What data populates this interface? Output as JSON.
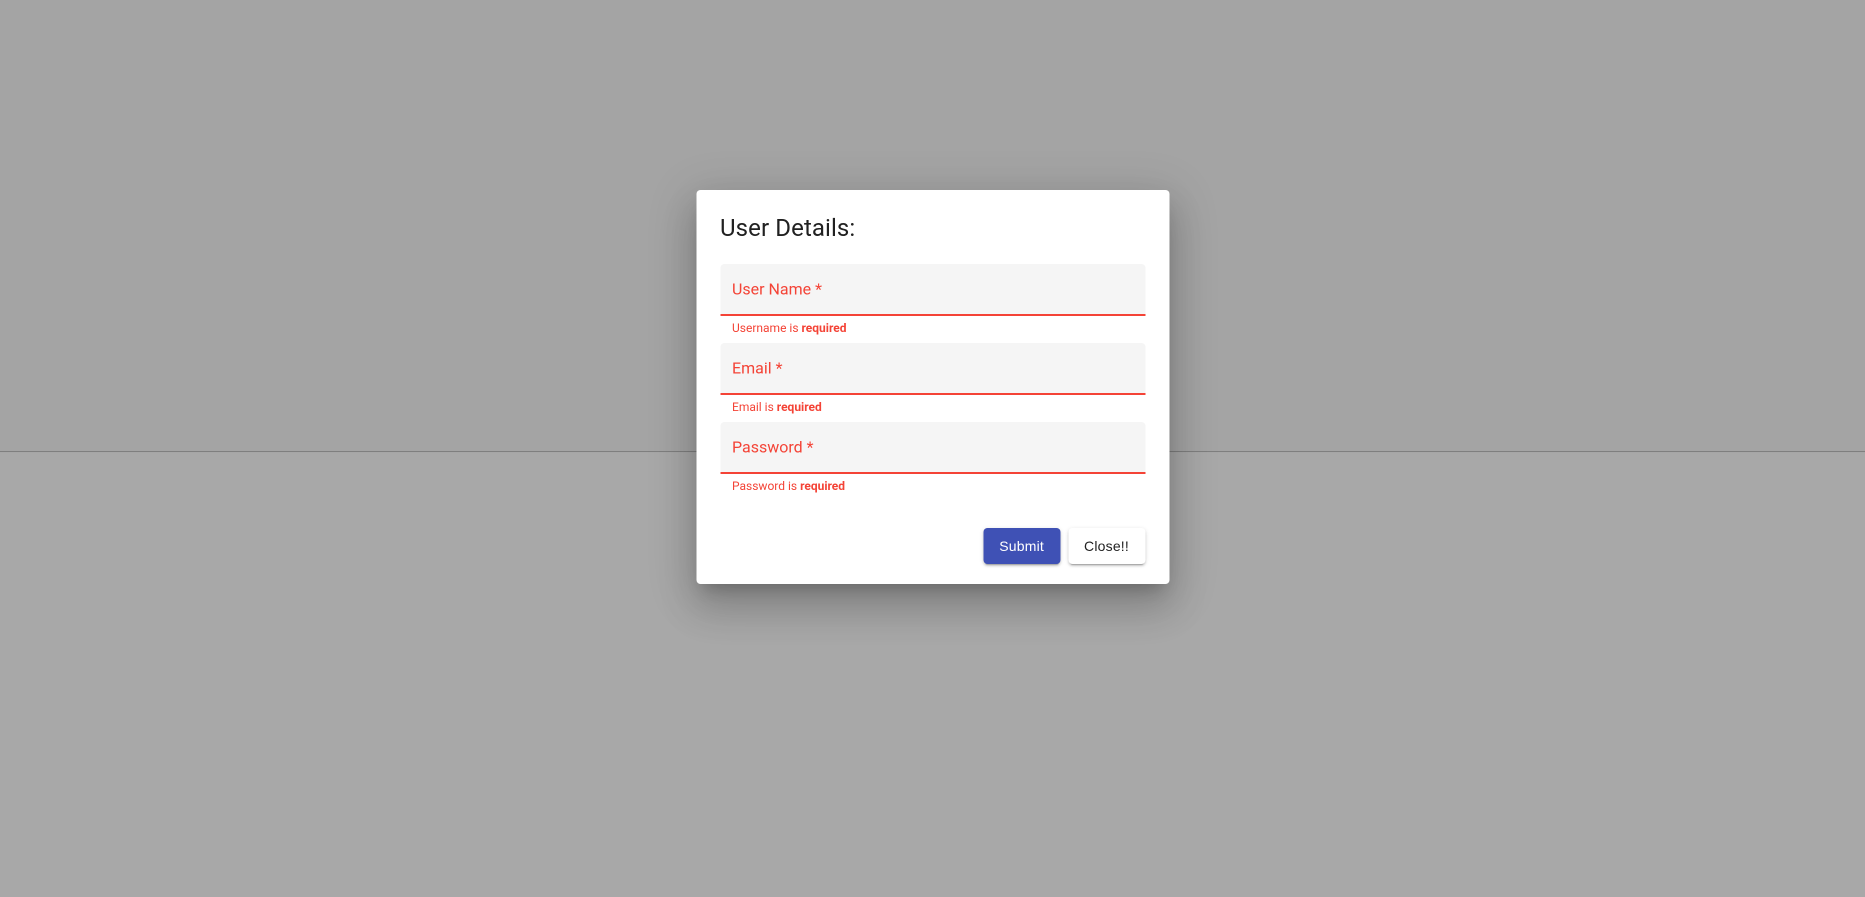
{
  "dialog": {
    "title": "User Details:",
    "fields": {
      "username": {
        "label": "User Name *",
        "error_prefix": "Username is ",
        "error_strong": "required"
      },
      "email": {
        "label": "Email *",
        "error_prefix": "Email is ",
        "error_strong": "required"
      },
      "password": {
        "label": "Password *",
        "error_prefix": "Password is ",
        "error_strong": "required"
      }
    },
    "actions": {
      "submit": "Submit",
      "close": "Close!!"
    }
  },
  "colors": {
    "error": "#f44336",
    "primary": "#3f51b5",
    "field_bg": "#f5f5f5"
  }
}
